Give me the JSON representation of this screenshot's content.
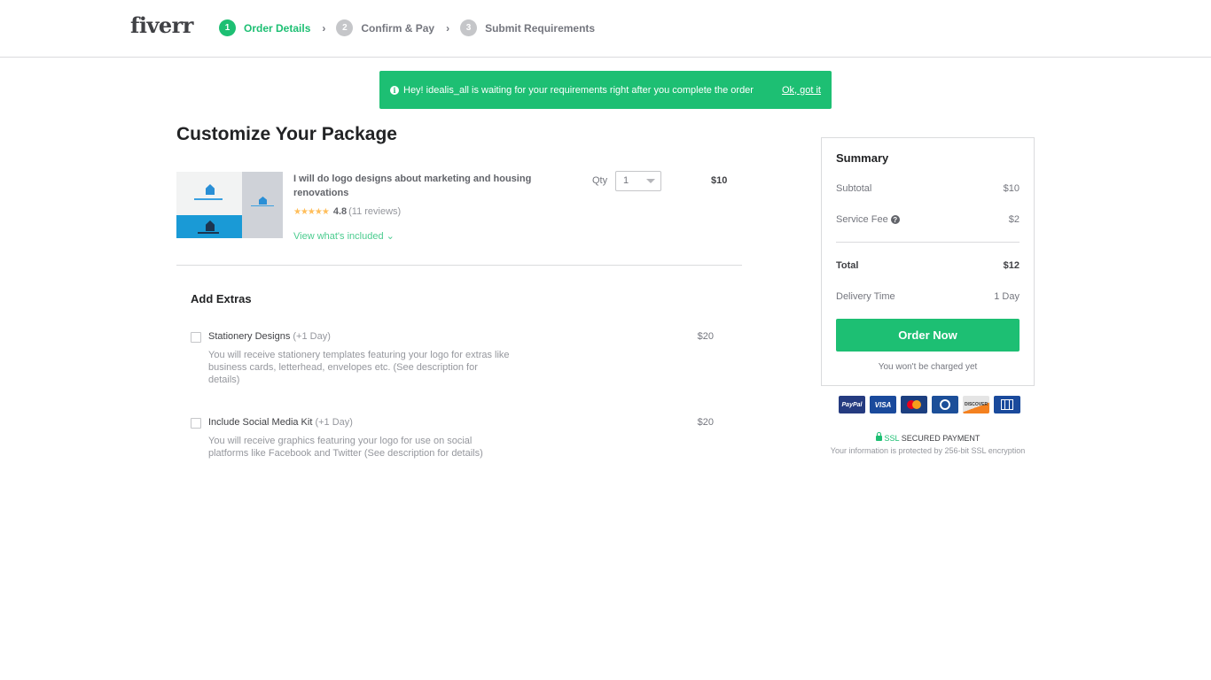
{
  "header": {
    "logo": "fiverr",
    "steps": [
      {
        "number": "1",
        "label": "Order Details",
        "active": true
      },
      {
        "number": "2",
        "label": "Confirm & Pay",
        "active": false
      },
      {
        "number": "3",
        "label": "Submit Requirements",
        "active": false
      }
    ],
    "chevron": "›"
  },
  "banner": {
    "icon": "info-icon",
    "message": "Hey! idealis_all is waiting for your requirements right after you complete the order",
    "dismiss_label": "Ok, got it"
  },
  "page_title": "Customize Your Package",
  "gig": {
    "title": "I will do logo designs about marketing and housing renovations",
    "stars": "★★★★★",
    "rating": "4.8",
    "reviews": "(11 reviews)",
    "view_included": "View what's included ⌄",
    "qty_label": "Qty",
    "qty_value": "1",
    "price": "$10"
  },
  "extras": {
    "title": "Add Extras",
    "items": [
      {
        "name": "Stationery Designs",
        "days": "(+1 Day)",
        "description": "You will receive stationery templates featuring your logo for extras like business cards, letterhead, envelopes etc. (See description for details)",
        "price": "$20",
        "checked": false
      },
      {
        "name": "Include Social Media Kit",
        "days": "(+1 Day)",
        "description": "You will receive graphics featuring your logo for use on social platforms like Facebook and Twitter (See description for details)",
        "price": "$20",
        "checked": false
      }
    ]
  },
  "summary": {
    "title": "Summary",
    "subtotal_label": "Subtotal",
    "subtotal_value": "$10",
    "service_fee_label": "Service Fee",
    "service_fee_value": "$2",
    "help_icon": "?",
    "total_label": "Total",
    "total_value": "$12",
    "delivery_label": "Delivery Time",
    "delivery_value": "1 Day",
    "order_button": "Order Now",
    "charged_note": "You won't be charged yet"
  },
  "payments": {
    "methods": [
      "PayPal",
      "VISA",
      "MasterCard",
      "Diners Club",
      "DISCOVER",
      "JCB"
    ],
    "paypal_label": "PayPal",
    "visa_label": "VISA",
    "discover_label": "DISCOVER"
  },
  "security": {
    "ssl_label": "SSL",
    "secured_label": "SECURED PAYMENT",
    "note": "Your information is protected by 256-bit SSL encryption"
  },
  "colors": {
    "brand_green": "#1dbf73",
    "text_dark": "#222325",
    "text_muted": "#95979d",
    "border": "#dadbdd"
  }
}
